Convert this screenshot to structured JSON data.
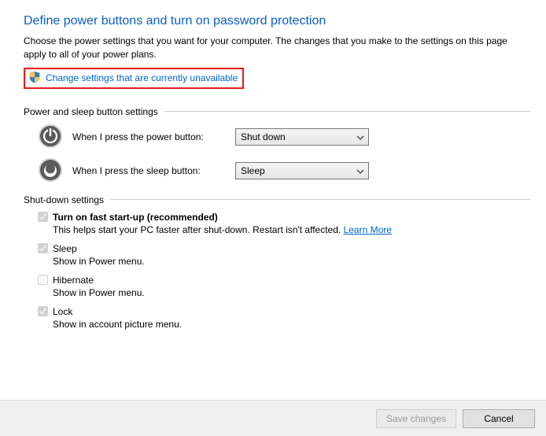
{
  "title": "Define power buttons and turn on password protection",
  "subtitle": "Choose the power settings that you want for your computer. The changes that you make to the settings on this page apply to all of your power plans.",
  "uac": {
    "link_text": "Change settings that are currently unavailable"
  },
  "section_power_buttons": "Power and sleep button settings",
  "power_button": {
    "label": "When I press the power button:",
    "value": "Shut down"
  },
  "sleep_button": {
    "label": "When I press the sleep button:",
    "value": "Sleep"
  },
  "section_shutdown": "Shut-down settings",
  "shutdown": {
    "fast_startup": {
      "title": "Turn on fast start-up (recommended)",
      "desc_prefix": "This helps start your PC faster after shut-down. Restart isn't affected. ",
      "learn_more": "Learn More",
      "checked": true
    },
    "sleep": {
      "title": "Sleep",
      "desc": "Show in Power menu.",
      "checked": true
    },
    "hibernate": {
      "title": "Hibernate",
      "desc": "Show in Power menu.",
      "checked": false
    },
    "lock": {
      "title": "Lock",
      "desc": "Show in account picture menu.",
      "checked": true
    }
  },
  "footer": {
    "save": "Save changes",
    "cancel": "Cancel"
  }
}
